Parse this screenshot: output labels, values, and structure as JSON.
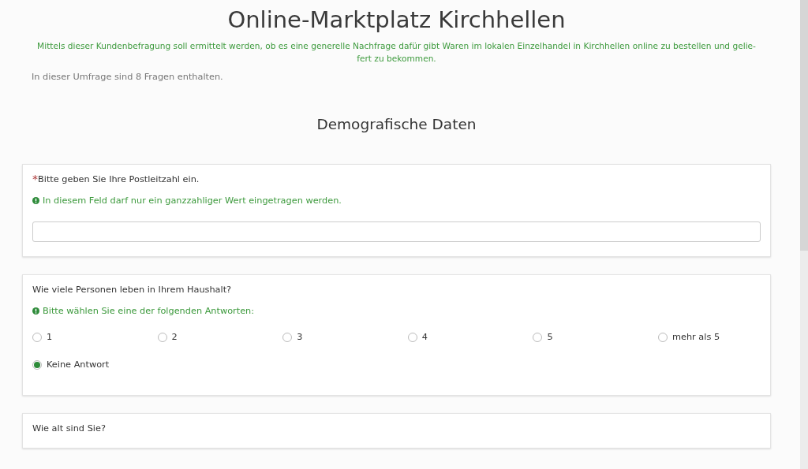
{
  "title": "Online-Marktplatz Kirchhellen",
  "description_lines": [
    "Mittels dieser Kundenbefragung soll ermittelt werden, ob es eine generelle Nachfrage dafür gibt Waren im lokalen Einzelhandel in Kirchhellen online zu bestellen und gelie-",
    "fert zu bekommen."
  ],
  "question_count_text": "In dieser Umfrage sind 8 Fragen enthalten.",
  "group_title": "Demografische Daten",
  "questions": [
    {
      "kind": "text",
      "required_mark": "*",
      "text": "Bitte geben Sie Ihre Postleitzahl ein.",
      "hint": "In diesem Feld darf nur ein ganzzahliger Wert eingetragen werden."
    },
    {
      "kind": "radio",
      "text": "Wie viele Personen leben in Ihrem Haushalt?",
      "hint": "Bitte wählen Sie eine der folgenden Antworten:",
      "options": [
        {
          "label": "1",
          "selected": false
        },
        {
          "label": "2",
          "selected": false
        },
        {
          "label": "3",
          "selected": false
        },
        {
          "label": "4",
          "selected": false
        },
        {
          "label": "5",
          "selected": false
        },
        {
          "label": "mehr als 5",
          "selected": false
        },
        {
          "label": "Keine Antwort",
          "selected": true
        }
      ]
    },
    {
      "kind": "plain",
      "text": "Wie alt sind Sie?"
    }
  ]
}
